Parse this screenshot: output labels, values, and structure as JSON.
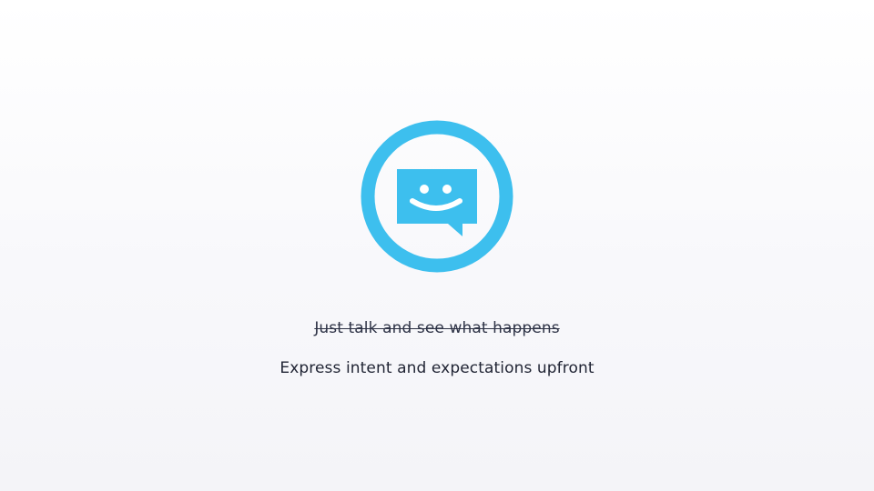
{
  "icon": {
    "name": "chat-smiley-icon",
    "color": "#3dbfee"
  },
  "text": {
    "struck": "Just talk and see what happens",
    "main": "Express intent and expectations upfront"
  }
}
